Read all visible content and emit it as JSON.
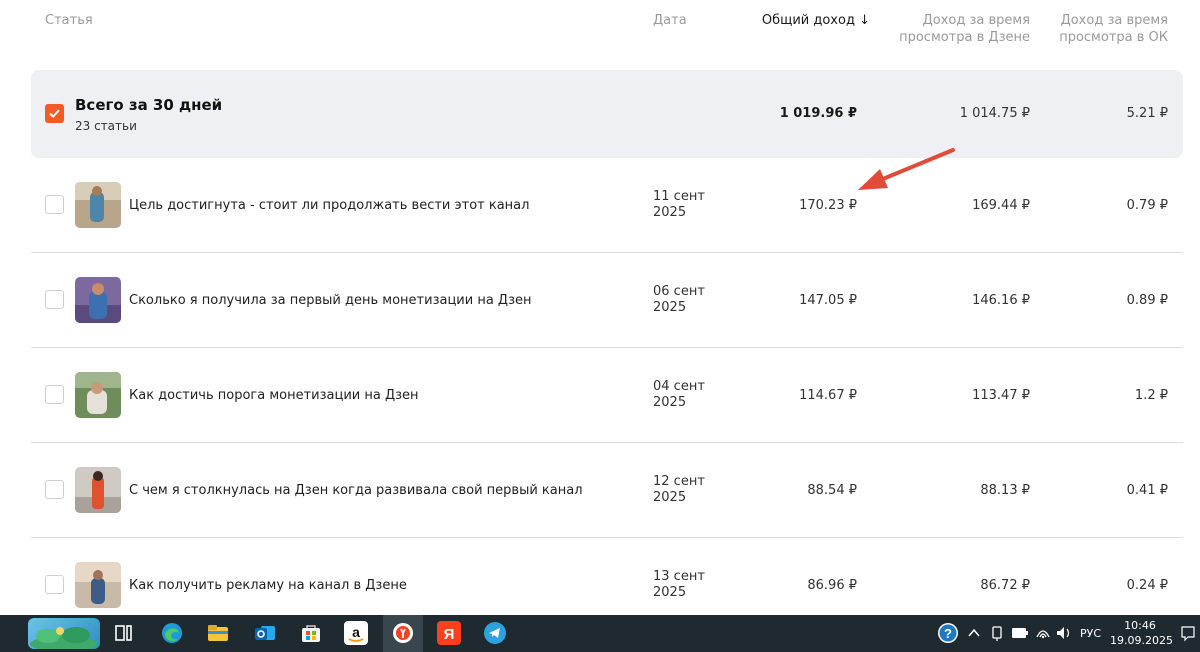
{
  "header": {
    "article": "Статья",
    "date": "Дата",
    "total": "Общий доход",
    "zen_line1": "Доход за время",
    "zen_line2": "просмотра в Дзене",
    "ok_line1": "Доход за время",
    "ok_line2": "просмотра в ОК"
  },
  "summary": {
    "title": "Всего за 30 дней",
    "subtitle": "23 статьи",
    "total": "1 019.96 ₽",
    "zen": "1 014.75 ₽",
    "ok": "5.21 ₽",
    "checked": true
  },
  "rows": [
    {
      "title": "Цель достигнута - стоит ли продолжать вести этот канал",
      "date1": "11 сент",
      "date2": "2025",
      "total": "170.23 ₽",
      "zen": "169.44 ₽",
      "ok": "0.79 ₽"
    },
    {
      "title": "Сколько я получила за первый день монетизации на Дзен",
      "date1": "06 сент",
      "date2": "2025",
      "total": "147.05 ₽",
      "zen": "146.16 ₽",
      "ok": "0.89 ₽"
    },
    {
      "title": "Как достичь порога монетизации на Дзен",
      "date1": "04 сент",
      "date2": "2025",
      "total": "114.67 ₽",
      "zen": "113.47 ₽",
      "ok": "1.2 ₽"
    },
    {
      "title": "С чем я столкнулась на Дзен когда развивала свой первый канал",
      "date1": "12 сент",
      "date2": "2025",
      "total": "88.54 ₽",
      "zen": "88.13 ₽",
      "ok": "0.41 ₽"
    },
    {
      "title": "Как получить рекламу на канал в Дзене",
      "date1": "13 сент",
      "date2": "2025",
      "total": "86.96 ₽",
      "zen": "86.72 ₽",
      "ok": "0.24 ₽"
    }
  ],
  "taskbar": {
    "lang": "РУС",
    "time": "10:46",
    "date": "19.09.2025",
    "icons": [
      "widgets-icon",
      "task-view-icon",
      "edge-icon",
      "file-explorer-icon",
      "outlook-icon",
      "store-icon",
      "amazon-icon",
      "yandex-browser-icon",
      "yandex-icon",
      "telegram-icon"
    ]
  },
  "colors": {
    "accent": "#f35b25",
    "arrow": "#e04b3a",
    "summary_bg": "#eef0f3",
    "taskbar_bg": "#1f2a30"
  }
}
